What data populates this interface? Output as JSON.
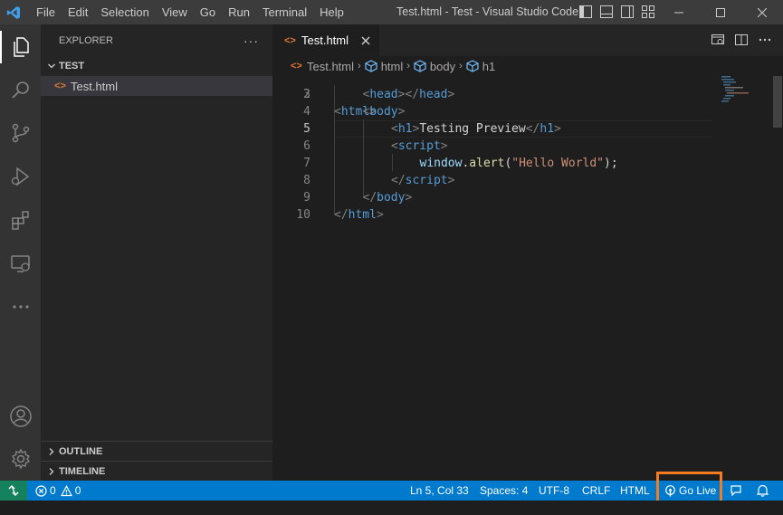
{
  "window": {
    "title": "Test.html - Test - Visual Studio Code",
    "menu": [
      "File",
      "Edit",
      "Selection",
      "View",
      "Go",
      "Run",
      "Terminal",
      "Help"
    ]
  },
  "activity_bar": {
    "items": [
      "files-icon",
      "search-icon",
      "source-control-icon",
      "run-debug-icon",
      "extensions-icon",
      "remote-explorer-icon",
      "more-icon"
    ],
    "bottom": [
      "account-icon",
      "manage-gear-icon"
    ]
  },
  "sidebar": {
    "title": "EXPLORER",
    "more": "···",
    "folder": "TEST",
    "file": "Test.html",
    "file_icon": "<>",
    "outline": "OUTLINE",
    "timeline": "TIMELINE"
  },
  "editor": {
    "tab_label": "Test.html",
    "tab_icon": "<>",
    "breadcrumbs": [
      "Test.html",
      "html",
      "body",
      "h1"
    ],
    "current_line": 5,
    "lines": [
      {
        "n": "2"
      },
      {
        "n": "3",
        "parts": [
          [
            "t-br",
            "<"
          ],
          [
            "t-tag",
            "head"
          ],
          [
            "t-br",
            "></"
          ],
          [
            "t-tag",
            "head"
          ],
          [
            "t-br",
            ">"
          ]
        ]
      },
      {
        "n": "4",
        "parts": [
          [
            "t-br",
            "<"
          ],
          [
            "t-tag",
            "body"
          ],
          [
            "t-br",
            ">"
          ]
        ]
      },
      {
        "n": "5",
        "parts": [
          [
            "t-br",
            "<"
          ],
          [
            "t-tag",
            "h1"
          ],
          [
            "t-br",
            ">"
          ],
          [
            "",
            "Testing Preview"
          ],
          [
            "t-br",
            "</"
          ],
          [
            "t-tag",
            "h1"
          ],
          [
            "t-br",
            ">"
          ]
        ]
      },
      {
        "n": "6",
        "parts": [
          [
            "t-br",
            "<"
          ],
          [
            "t-tag",
            "script"
          ],
          [
            "t-br",
            ">"
          ]
        ]
      },
      {
        "n": "7",
        "parts": [
          [
            "t-id",
            "window"
          ],
          [
            "",
            "."
          ],
          [
            "t-fn",
            "alert"
          ],
          [
            "",
            "("
          ],
          [
            "t-str",
            "\"Hello World\""
          ],
          [
            "",
            ");"
          ]
        ]
      },
      {
        "n": "8",
        "parts": [
          [
            "t-br",
            "</"
          ],
          [
            "t-tag",
            "script"
          ],
          [
            "t-br",
            ">"
          ]
        ]
      },
      {
        "n": "9",
        "parts": [
          [
            "t-br",
            "</"
          ],
          [
            "t-tag",
            "body"
          ],
          [
            "t-br",
            ">"
          ]
        ]
      },
      {
        "n": "10",
        "parts": [
          [
            "t-br",
            "</"
          ],
          [
            "t-tag",
            "html"
          ],
          [
            "t-br",
            ">"
          ]
        ]
      }
    ]
  },
  "status_bar": {
    "errors": "0",
    "warnings": "0",
    "position": "Ln 5, Col 33",
    "spaces": "Spaces: 4",
    "encoding": "UTF-8",
    "eol": "CRLF",
    "language": "HTML",
    "go_live": "Go Live"
  },
  "colors": {
    "status_bar": "#007acc",
    "remote": "#16825d",
    "highlight_box": "#f47b20",
    "html_icon": "#e37933"
  }
}
